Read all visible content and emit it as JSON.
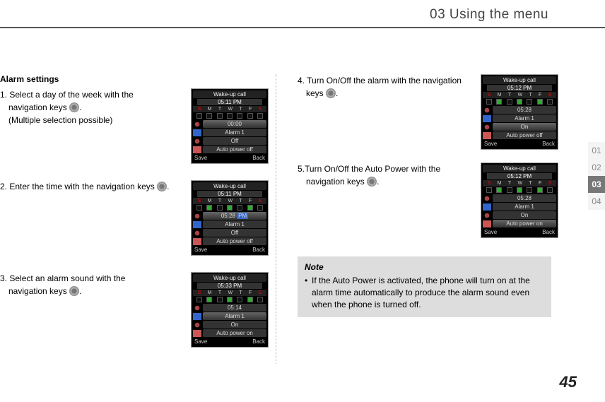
{
  "header": {
    "title": "03 Using the menu"
  },
  "side_tabs": [
    "01",
    "02",
    "03",
    "04"
  ],
  "active_tab": "03",
  "page_number": "45",
  "left": {
    "section_title": "Alarm settings",
    "steps": [
      {
        "num": "1.",
        "text_a": "Select a day of the week with the",
        "text_b": "navigation keys ",
        "text_c": "(Multiple selection possible)"
      },
      {
        "num": "2.",
        "text_a": "Enter the time with the navigation keys "
      },
      {
        "num": "3.",
        "text_a": "Select an alarm sound with the",
        "text_b": "navigation keys "
      }
    ]
  },
  "right": {
    "steps": [
      {
        "num": "4.",
        "text_a": "Turn On/Off the alarm with the navigation",
        "text_b": "keys "
      },
      {
        "num": "5.",
        "text_a": "Turn On/Off the Auto Power with the",
        "text_b": "navigation keys "
      }
    ],
    "note_title": "Note",
    "note_item": "If the Auto Power is activated, the phone will turn on at the alarm time automatically to produce the alarm sound even when the phone is turned off."
  },
  "shots": {
    "title": "Wake-up call",
    "days": [
      "S",
      "M",
      "T",
      "W",
      "T",
      "F",
      "S"
    ],
    "save": "Save",
    "back": "Back",
    "s1": {
      "time": "05:11 PM",
      "r1": "00:00",
      "r2": "Alarm 1",
      "r3": "Off",
      "r4": "Auto power off"
    },
    "s2": {
      "time": "05:11 PM",
      "r1": "05:28",
      "pm": "PM",
      "r2": "Alarm 1",
      "r3": "Off",
      "r4": "Auto power off"
    },
    "s3": {
      "time": "05:33 PM",
      "r1": "05:14",
      "r2": "Alarm 1",
      "r3": "On",
      "r4": "Auto power on"
    },
    "s4": {
      "time": "05:12 PM",
      "r1": "05:28",
      "r2": "Alarm 1",
      "r3": "On",
      "r4": "Auto power off"
    },
    "s5": {
      "time": "05:12 PM",
      "r1": "05:28",
      "r2": "Alarm 1",
      "r3": "On",
      "r4": "Auto power on"
    }
  }
}
